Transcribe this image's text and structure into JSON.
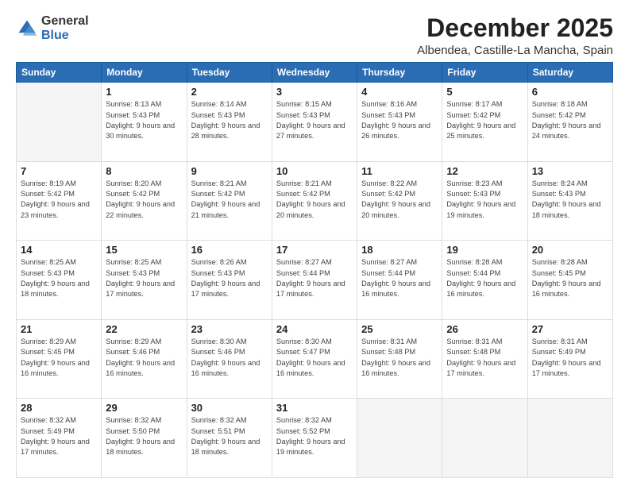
{
  "logo": {
    "general": "General",
    "blue": "Blue"
  },
  "header": {
    "title": "December 2025",
    "subtitle": "Albendea, Castille-La Mancha, Spain"
  },
  "weekdays": [
    "Sunday",
    "Monday",
    "Tuesday",
    "Wednesday",
    "Thursday",
    "Friday",
    "Saturday"
  ],
  "weeks": [
    [
      {
        "day": "",
        "empty": true
      },
      {
        "day": "1",
        "sunrise": "8:13 AM",
        "sunset": "5:43 PM",
        "daylight": "9 hours and 30 minutes."
      },
      {
        "day": "2",
        "sunrise": "8:14 AM",
        "sunset": "5:43 PM",
        "daylight": "9 hours and 28 minutes."
      },
      {
        "day": "3",
        "sunrise": "8:15 AM",
        "sunset": "5:43 PM",
        "daylight": "9 hours and 27 minutes."
      },
      {
        "day": "4",
        "sunrise": "8:16 AM",
        "sunset": "5:43 PM",
        "daylight": "9 hours and 26 minutes."
      },
      {
        "day": "5",
        "sunrise": "8:17 AM",
        "sunset": "5:42 PM",
        "daylight": "9 hours and 25 minutes."
      },
      {
        "day": "6",
        "sunrise": "8:18 AM",
        "sunset": "5:42 PM",
        "daylight": "9 hours and 24 minutes."
      }
    ],
    [
      {
        "day": "7",
        "sunrise": "8:19 AM",
        "sunset": "5:42 PM",
        "daylight": "9 hours and 23 minutes."
      },
      {
        "day": "8",
        "sunrise": "8:20 AM",
        "sunset": "5:42 PM",
        "daylight": "9 hours and 22 minutes."
      },
      {
        "day": "9",
        "sunrise": "8:21 AM",
        "sunset": "5:42 PM",
        "daylight": "9 hours and 21 minutes."
      },
      {
        "day": "10",
        "sunrise": "8:21 AM",
        "sunset": "5:42 PM",
        "daylight": "9 hours and 20 minutes."
      },
      {
        "day": "11",
        "sunrise": "8:22 AM",
        "sunset": "5:42 PM",
        "daylight": "9 hours and 20 minutes."
      },
      {
        "day": "12",
        "sunrise": "8:23 AM",
        "sunset": "5:43 PM",
        "daylight": "9 hours and 19 minutes."
      },
      {
        "day": "13",
        "sunrise": "8:24 AM",
        "sunset": "5:43 PM",
        "daylight": "9 hours and 18 minutes."
      }
    ],
    [
      {
        "day": "14",
        "sunrise": "8:25 AM",
        "sunset": "5:43 PM",
        "daylight": "9 hours and 18 minutes."
      },
      {
        "day": "15",
        "sunrise": "8:25 AM",
        "sunset": "5:43 PM",
        "daylight": "9 hours and 17 minutes."
      },
      {
        "day": "16",
        "sunrise": "8:26 AM",
        "sunset": "5:43 PM",
        "daylight": "9 hours and 17 minutes."
      },
      {
        "day": "17",
        "sunrise": "8:27 AM",
        "sunset": "5:44 PM",
        "daylight": "9 hours and 17 minutes."
      },
      {
        "day": "18",
        "sunrise": "8:27 AM",
        "sunset": "5:44 PM",
        "daylight": "9 hours and 16 minutes."
      },
      {
        "day": "19",
        "sunrise": "8:28 AM",
        "sunset": "5:44 PM",
        "daylight": "9 hours and 16 minutes."
      },
      {
        "day": "20",
        "sunrise": "8:28 AM",
        "sunset": "5:45 PM",
        "daylight": "9 hours and 16 minutes."
      }
    ],
    [
      {
        "day": "21",
        "sunrise": "8:29 AM",
        "sunset": "5:45 PM",
        "daylight": "9 hours and 16 minutes."
      },
      {
        "day": "22",
        "sunrise": "8:29 AM",
        "sunset": "5:46 PM",
        "daylight": "9 hours and 16 minutes."
      },
      {
        "day": "23",
        "sunrise": "8:30 AM",
        "sunset": "5:46 PM",
        "daylight": "9 hours and 16 minutes."
      },
      {
        "day": "24",
        "sunrise": "8:30 AM",
        "sunset": "5:47 PM",
        "daylight": "9 hours and 16 minutes."
      },
      {
        "day": "25",
        "sunrise": "8:31 AM",
        "sunset": "5:48 PM",
        "daylight": "9 hours and 16 minutes."
      },
      {
        "day": "26",
        "sunrise": "8:31 AM",
        "sunset": "5:48 PM",
        "daylight": "9 hours and 17 minutes."
      },
      {
        "day": "27",
        "sunrise": "8:31 AM",
        "sunset": "5:49 PM",
        "daylight": "9 hours and 17 minutes."
      }
    ],
    [
      {
        "day": "28",
        "sunrise": "8:32 AM",
        "sunset": "5:49 PM",
        "daylight": "9 hours and 17 minutes."
      },
      {
        "day": "29",
        "sunrise": "8:32 AM",
        "sunset": "5:50 PM",
        "daylight": "9 hours and 18 minutes."
      },
      {
        "day": "30",
        "sunrise": "8:32 AM",
        "sunset": "5:51 PM",
        "daylight": "9 hours and 18 minutes."
      },
      {
        "day": "31",
        "sunrise": "8:32 AM",
        "sunset": "5:52 PM",
        "daylight": "9 hours and 19 minutes."
      },
      {
        "day": "",
        "empty": true
      },
      {
        "day": "",
        "empty": true
      },
      {
        "day": "",
        "empty": true
      }
    ]
  ]
}
